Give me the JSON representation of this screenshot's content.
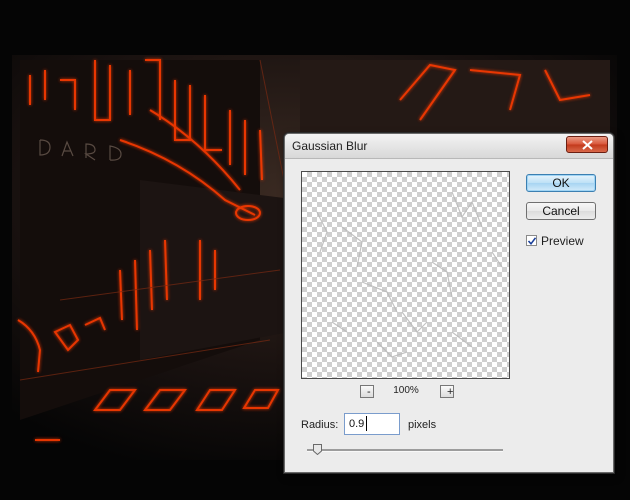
{
  "dialog": {
    "title": "Gaussian Blur",
    "ok_label": "OK",
    "cancel_label": "Cancel",
    "preview_label": "Preview",
    "preview_checked": true,
    "zoom_out_label": "-",
    "zoom_in_label": "+",
    "zoom_level": "100%",
    "radius_label": "Radius:",
    "radius_value": "0.9",
    "units_label": "pixels",
    "slider_value_fraction": 0.05
  },
  "colors": {
    "glow": "#ff3b00",
    "close_button": "#d9573b",
    "ok_button": "#bde0f6"
  },
  "icons": {
    "close": "close-icon",
    "checkbox": "checkmark-icon"
  }
}
